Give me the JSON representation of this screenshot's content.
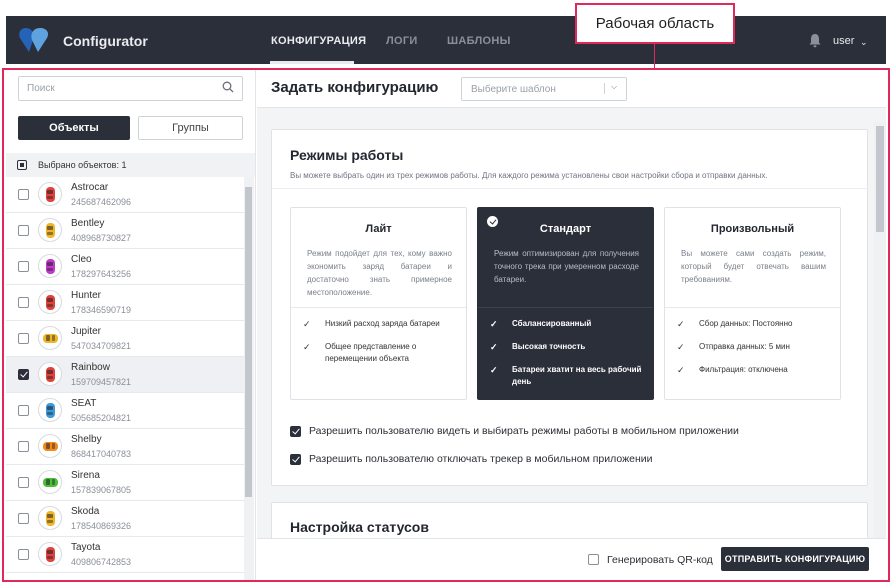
{
  "header": {
    "brand": "Configurator",
    "nav": [
      {
        "label": "КОНФИГУРАЦИЯ",
        "active": true
      },
      {
        "label": "ЛОГИ",
        "active": false
      },
      {
        "label": "ШАБЛОНЫ",
        "active": false
      }
    ],
    "user": "user",
    "colors": {
      "bar": "#2b2f3a",
      "logo_dark": "#2563b8",
      "logo_light": "#5fa2e0"
    }
  },
  "annotation": {
    "label": "Рабочая область",
    "color": "#e0295b"
  },
  "sidebar": {
    "search_placeholder": "Поиск",
    "tabs": {
      "objects": "Объекты",
      "groups": "Группы"
    },
    "selected_text": "Выбрано объектов: 1",
    "objects": [
      {
        "name": "Astrocar",
        "id": "245687462096",
        "checked": false,
        "color": "#e0433b",
        "icon": "car-icon"
      },
      {
        "name": "Bentley",
        "id": "408968730827",
        "checked": false,
        "color": "#f0b429",
        "icon": "car-icon"
      },
      {
        "name": "Cleo",
        "id": "178297643256",
        "checked": false,
        "color": "#c03ac8",
        "icon": "car-icon"
      },
      {
        "name": "Hunter",
        "id": "178346590719",
        "checked": false,
        "color": "#e0433b",
        "icon": "car-icon"
      },
      {
        "name": "Jupiter",
        "id": "547034709821",
        "checked": false,
        "color": "#f0b429",
        "icon": "car-icon"
      },
      {
        "name": "Rainbow",
        "id": "159709457821",
        "checked": true,
        "color": "#e0433b",
        "icon": "car-icon"
      },
      {
        "name": "SEAT",
        "id": "505685204821",
        "checked": false,
        "color": "#3b9ad9",
        "icon": "car-icon"
      },
      {
        "name": "Shelby",
        "id": "868417040783",
        "checked": false,
        "color": "#f08a1c",
        "icon": "car-icon"
      },
      {
        "name": "Sirena",
        "id": "157839067805",
        "checked": false,
        "color": "#4bbf3a",
        "icon": "car-icon"
      },
      {
        "name": "Skoda",
        "id": "178540869326",
        "checked": false,
        "color": "#f0b429",
        "icon": "car-icon"
      },
      {
        "name": "Tayota",
        "id": "409806742853",
        "checked": false,
        "color": "#e0433b",
        "icon": "car-icon"
      }
    ]
  },
  "main": {
    "title": "Задать конфигурацию",
    "template_placeholder": "Выберите шаблон",
    "modes_card": {
      "title": "Режимы работы",
      "description": "Вы можете выбрать один из трех режимов работы. Для каждого режима установлены свои настройки сбора и отправки данных.",
      "modes": [
        {
          "title": "Лайт",
          "selected": false,
          "description": "Режим подойдет для тех, кому важно экономить заряд батареи и достаточно знать примерное местоположение.",
          "features": [
            "Низкий расход заряда батареи",
            "Общее представление о перемещении объекта"
          ]
        },
        {
          "title": "Стандарт",
          "selected": true,
          "description": "Режим оптимизирован для получения точного трека при умеренном расходе батареи.",
          "features": [
            "Сбалансированный",
            "Высокая точность",
            "Батареи хватит на весь рабочий день"
          ]
        },
        {
          "title": "Произвольный",
          "selected": false,
          "description": "Вы можете сами создать режим, который будет отвечать вашим требованиям.",
          "features": [
            "Сбор данных: Постоянно",
            "Отправка данных: 5 мин",
            "Фильтрация: отключена"
          ]
        }
      ],
      "options": [
        {
          "label": "Разрешить пользователю видеть и выбирать режимы работы в мобильном приложении",
          "checked": true
        },
        {
          "label": "Разрешить пользователю отключать трекер в мобильном приложении",
          "checked": true
        }
      ]
    },
    "status_card": {
      "title": "Настройка статусов"
    },
    "footer": {
      "qr_label": "Генерировать QR-код",
      "qr_checked": false,
      "send_label": "ОТПРАВИТЬ КОНФИГУРАЦИЮ"
    }
  }
}
